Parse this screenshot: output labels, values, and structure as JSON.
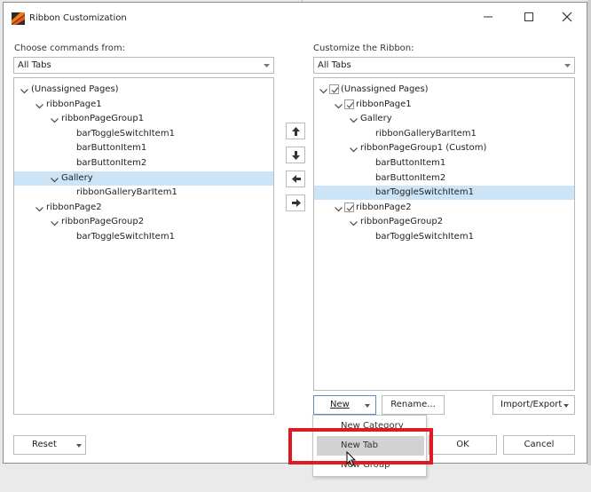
{
  "window": {
    "title": "Ribbon Customization",
    "controls": [
      "minimize-icon",
      "maximize-icon",
      "close-icon"
    ]
  },
  "left": {
    "label": "Choose commands from:",
    "combo_value": "All Tabs",
    "tree": [
      {
        "text": "(Unassigned Pages)",
        "level": 0,
        "expanded": true
      },
      {
        "text": "ribbonPage1",
        "level": 1,
        "expanded": true
      },
      {
        "text": "ribbonPageGroup1",
        "level": 2,
        "expanded": true
      },
      {
        "text": "barToggleSwitchItem1",
        "level": 3
      },
      {
        "text": "barButtonItem1",
        "level": 3
      },
      {
        "text": "barButtonItem2",
        "level": 3
      },
      {
        "text": "Gallery",
        "level": 2,
        "expanded": true,
        "selected": true
      },
      {
        "text": "ribbonGalleryBarItem1",
        "level": 3
      },
      {
        "text": "ribbonPage2",
        "level": 1,
        "expanded": true
      },
      {
        "text": "ribbonPageGroup2",
        "level": 2,
        "expanded": true
      },
      {
        "text": "barToggleSwitchItem1",
        "level": 3
      }
    ],
    "reset_label": "Reset"
  },
  "move_buttons": [
    "arrow-up-icon",
    "arrow-down-icon",
    "arrow-left-icon",
    "arrow-right-icon"
  ],
  "right": {
    "label": "Customize the Ribbon:",
    "combo_value": "All Tabs",
    "tree": [
      {
        "text": "(Unassigned Pages)",
        "level": 0,
        "expanded": true,
        "checked": true
      },
      {
        "text": "ribbonPage1",
        "level": 1,
        "expanded": true,
        "checked": true
      },
      {
        "text": "Gallery",
        "level": 2,
        "expanded": true
      },
      {
        "text": "ribbonGalleryBarItem1",
        "level": 3
      },
      {
        "text": "ribbonPageGroup1 (Custom)",
        "level": 2,
        "expanded": true
      },
      {
        "text": "barButtonItem1",
        "level": 3
      },
      {
        "text": "barButtonItem2",
        "level": 3
      },
      {
        "text": "barToggleSwitchItem1",
        "level": 3,
        "selected": true
      },
      {
        "text": "ribbonPage2",
        "level": 1,
        "expanded": true,
        "checked": true
      },
      {
        "text": "ribbonPageGroup2",
        "level": 2,
        "expanded": true
      },
      {
        "text": "barToggleSwitchItem1",
        "level": 3
      }
    ],
    "new_label": "New",
    "rename_label": "Rename...",
    "import_export_label": "Import/Export"
  },
  "new_menu": {
    "items": [
      "New Category",
      "New Tab",
      "New Group"
    ],
    "highlighted": "New Tab"
  },
  "footer": {
    "ok_label": "OK",
    "cancel_label": "Cancel"
  },
  "colors": {
    "selection": "#cde4f7",
    "highlight_box": "#e01a22",
    "menu_hover": "#d2d2d2"
  }
}
